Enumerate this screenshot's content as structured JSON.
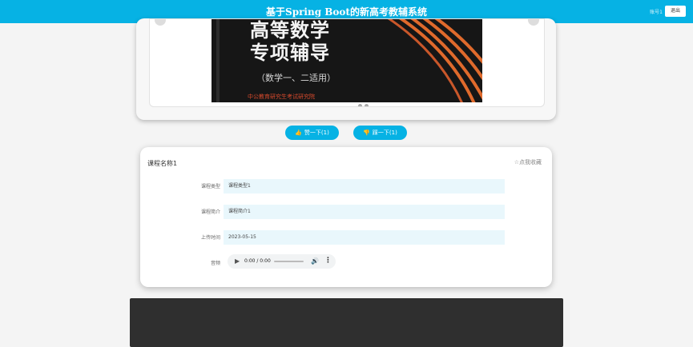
{
  "header": {
    "title": "基于Spring Boot的新高考教辅系统",
    "user": "账号1",
    "logout_label": "退出"
  },
  "carousel": {
    "cover_line1": "高等数学",
    "cover_line2": "专项辅导",
    "cover_subtitle": "（数学一、二适用）",
    "cover_publisher": "中公教育研究生考试研究院",
    "slide_count": 3,
    "active_slide": 0
  },
  "actions": {
    "like_label": "赞一下(1)",
    "dislike_label": "踩一下(1)"
  },
  "course": {
    "name": "课程名称1",
    "favorite_label": "☆点我收藏",
    "fields": [
      {
        "label": "课程类型",
        "value": "课程类型1"
      },
      {
        "label": "课程简介",
        "value": "课程简介1"
      },
      {
        "label": "上传时间",
        "value": "2023-05-15"
      }
    ],
    "audio_label": "音频",
    "audio_time": "0:00 / 0:00"
  },
  "colors": {
    "accent": "#06b2e4",
    "field_bg": "#e9f7fc",
    "page_bg": "#f4f4f4",
    "dark_panel": "#2f2f2f"
  }
}
